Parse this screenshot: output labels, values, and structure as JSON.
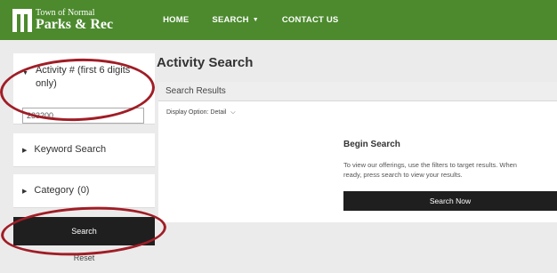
{
  "header": {
    "logo": {
      "line1": "Town of Normal",
      "line2": "Parks & Rec"
    },
    "nav": [
      {
        "label": "HOME",
        "has_dropdown": false
      },
      {
        "label": "SEARCH",
        "has_dropdown": true
      },
      {
        "label": "CONTACT US",
        "has_dropdown": false
      }
    ],
    "accent_color": "#4c8a2d"
  },
  "sidebar": {
    "activity": {
      "label": "Activity # (first 6 digits only)",
      "value": "233200",
      "expanded": true
    },
    "keyword": {
      "label": "Keyword Search",
      "expanded": false
    },
    "category": {
      "label": "Category",
      "count": "(0)",
      "expanded": false
    },
    "search_button": "Search",
    "reset_link": "Reset"
  },
  "main": {
    "title": "Activity Search",
    "results_header": "Search Results",
    "display_option_label": "Display Option:",
    "display_option_value": "Detail",
    "begin_title": "Begin Search",
    "begin_text_line1": "To view our offerings, use the filters to target results. When",
    "begin_text_line2": "ready, press search to view your results.",
    "search_now": "Search Now"
  },
  "annotation_color": "#a01d26"
}
